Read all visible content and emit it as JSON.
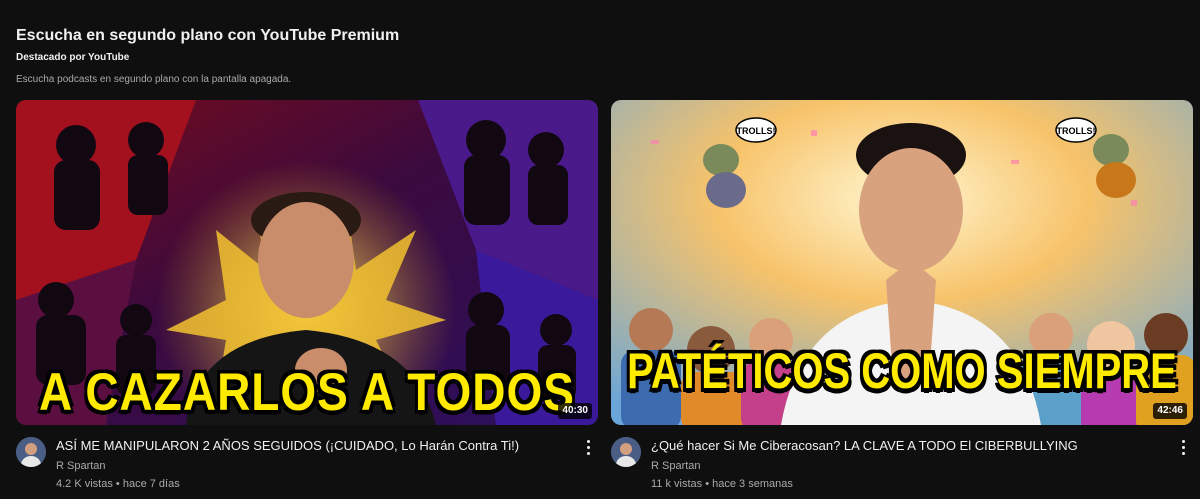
{
  "shelf": {
    "title": "Escucha en segundo plano con YouTube Premium",
    "subtitle": "Destacado por YouTube",
    "description": "Escucha podcasts en segundo plano con la pantalla apagada."
  },
  "videos": [
    {
      "thumb_caption": "A CAZARLOS A TODOS",
      "duration": "40:30",
      "title": "ASÍ ME MANIPULARON 2 AÑOS SEGUIDOS (¡CUIDADO, Lo Harán Contra Ti!)",
      "channel": "R Spartan",
      "views": "4.2 K vistas",
      "separator": "•",
      "age": "hace 7 días",
      "menu_icon": "kebab-vertical-icon"
    },
    {
      "thumb_caption": "PATÉTICOS COMO SIEMPRE",
      "thumb_badge": "TROLLS!",
      "duration": "42:46",
      "title": "¿Qué hacer Si Me Ciberacosan? LA CLAVE A TODO El CIBERBULLYING",
      "channel": "R Spartan",
      "views": "11 k vistas",
      "separator": "•",
      "age": "hace 3 semanas",
      "menu_icon": "kebab-vertical-icon"
    }
  ],
  "colors": {
    "background": "#0f0f0f",
    "caption_yellow": "#ffeb00",
    "secondary_text": "#aaaaaa"
  }
}
